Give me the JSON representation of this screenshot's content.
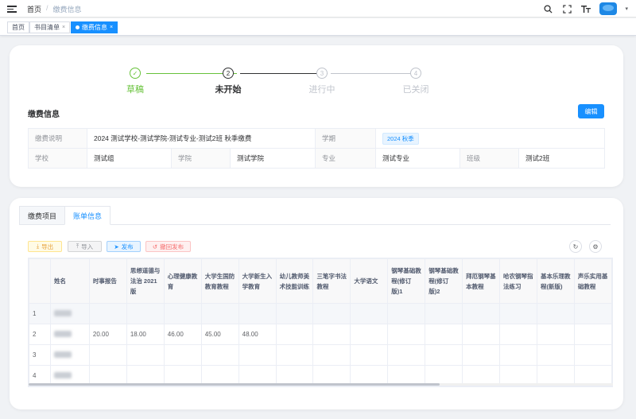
{
  "navbar": {
    "breadcrumb": {
      "home": "首页",
      "separator": "/",
      "current": "缴费信息"
    },
    "icons": [
      "search-icon",
      "fullscreen-icon",
      "font-size-icon",
      "user-avatar"
    ]
  },
  "tags": {
    "items": [
      {
        "label": "首页",
        "active": false
      },
      {
        "label": "书目清单",
        "active": false
      },
      {
        "label": "缴费信息",
        "active": true
      }
    ],
    "close_glyph": "×"
  },
  "steps": {
    "items": [
      {
        "label": "草稿",
        "number": "✓",
        "status": "done"
      },
      {
        "label": "未开始",
        "number": "2",
        "status": "current"
      },
      {
        "label": "进行中",
        "number": "3",
        "status": "wait"
      },
      {
        "label": "已关闭",
        "number": "4",
        "status": "wait"
      }
    ]
  },
  "info": {
    "title": "缴费信息",
    "edit_label": "编辑",
    "desc_label": "缴费说明",
    "desc_value": "2024 测试学校-测试学院-测试专业-测试2班 秋季缴费",
    "term_label": "学期",
    "term_value": "2024 秋季",
    "school_label": "学校",
    "school_value": "测试组",
    "college_label": "学院",
    "college_value": "测试学院",
    "major_label": "专业",
    "major_value": "测试专业",
    "class_label": "班级",
    "class_value": "测试2班"
  },
  "bill": {
    "tabs": [
      {
        "label": "缴费项目",
        "active": false
      },
      {
        "label": "账单信息",
        "active": true
      }
    ],
    "toolbar": {
      "export": "导出",
      "import": "导入",
      "publish": "发布",
      "revoke": "撤回发布"
    },
    "columns": [
      "",
      "姓名",
      "时事报告",
      "思想道德与法治 2021版",
      "心理健康教育",
      "大学生国防教育教程",
      "大学新生入学教育",
      "幼儿教师美术技能训练",
      "三笔字书法教程",
      "大学语文",
      "钢琴基础教程(修订版)1",
      "钢琴基础教程(修订版)2",
      "拜厄钢琴基本教程",
      "哈农钢琴指法练习",
      "基本乐理教程(新版)",
      "声乐实用基础教程"
    ],
    "rows": [
      [
        "1",
        "",
        "",
        "",
        "",
        "",
        "",
        "",
        "",
        "",
        "",
        "",
        "",
        "",
        "",
        ""
      ],
      [
        "2",
        "",
        "20.00",
        "18.00",
        "46.00",
        "45.00",
        "48.00",
        "",
        "",
        "",
        "",
        "",
        "",
        "",
        "",
        ""
      ],
      [
        "3",
        "",
        "",
        "",
        "",
        "",
        "",
        "",
        "",
        "",
        "",
        "",
        "",
        "",
        "",
        ""
      ],
      [
        "4",
        "",
        "",
        "",
        "",
        "",
        "",
        "",
        "",
        "",
        "",
        "",
        "",
        "",
        "",
        ""
      ]
    ]
  },
  "colors": {
    "primary": "#1890ff",
    "success": "#67c23a",
    "warning": "#e6a23c",
    "danger": "#f56c6c"
  }
}
